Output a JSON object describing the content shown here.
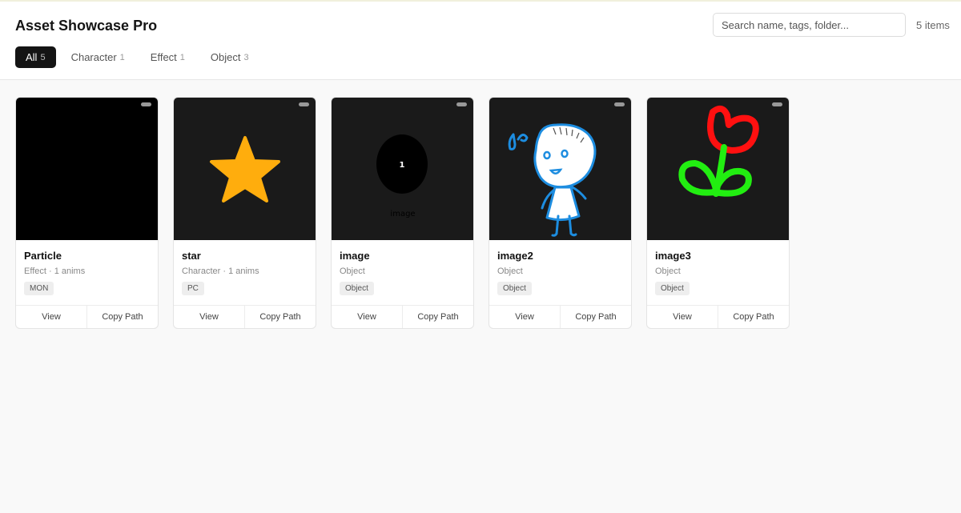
{
  "header": {
    "title": "Asset Showcase Pro",
    "search_placeholder": "Search name, tags, folder...",
    "item_count": "5 items"
  },
  "tabs": [
    {
      "label": "All",
      "count": "5",
      "active": true
    },
    {
      "label": "Character",
      "count": "1"
    },
    {
      "label": "Effect",
      "count": "1"
    },
    {
      "label": "Object",
      "count": "3"
    }
  ],
  "cards": [
    {
      "name": "Particle",
      "meta": "Effect · 1 anims",
      "tag": "MON",
      "view_label": "View",
      "copy_label": "Copy Path"
    },
    {
      "name": "star",
      "meta": "Character · 1 anims",
      "tag": "PC",
      "view_label": "View",
      "copy_label": "Copy Path"
    },
    {
      "name": "image",
      "meta": "Object",
      "tag": "Object",
      "view_label": "View",
      "copy_label": "Copy Path",
      "thumb_number": "1",
      "thumb_caption": "image"
    },
    {
      "name": "image2",
      "meta": "Object",
      "tag": "Object",
      "view_label": "View",
      "copy_label": "Copy Path"
    },
    {
      "name": "image3",
      "meta": "Object",
      "tag": "Object",
      "view_label": "View",
      "copy_label": "Copy Path"
    }
  ],
  "colors": {
    "star": "#ffad0d",
    "doodle_blue": "#1d8de0",
    "flower_red": "#ff1010",
    "leaf_green": "#22ee11"
  }
}
